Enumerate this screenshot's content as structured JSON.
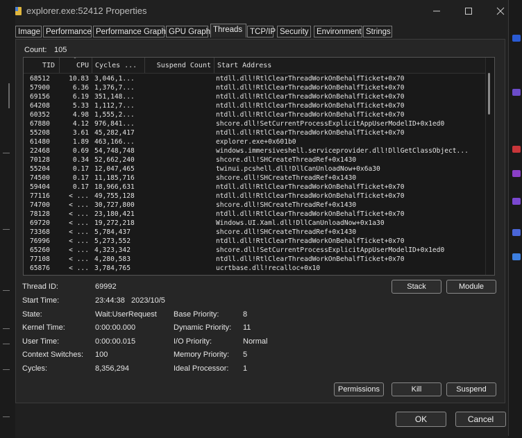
{
  "window": {
    "title": "explorer.exe:52412 Properties",
    "minimize_icon": "minimize-icon",
    "maximize_icon": "maximize-icon",
    "close_icon": "close-icon"
  },
  "tabs": [
    {
      "label": "Image"
    },
    {
      "label": "Performance"
    },
    {
      "label": "Performance Graph"
    },
    {
      "label": "GPU Graph"
    },
    {
      "label": "Threads",
      "active": true
    },
    {
      "label": "TCP/IP"
    },
    {
      "label": "Security"
    },
    {
      "label": "Environment"
    },
    {
      "label": "Strings"
    }
  ],
  "threads": {
    "count_label": "Count:",
    "count_value": "105",
    "columns": {
      "tid": "TID",
      "cpu": "CPU",
      "cycles": "Cycles ...",
      "suspend": "Suspend Count",
      "address": "Start Address"
    },
    "rows": [
      {
        "tid": "68512",
        "cpu": "10.83",
        "cycles": "3,046,1...",
        "address": "ntdll.dll!RtlClearThreadWorkOnBehalfTicket+0x70"
      },
      {
        "tid": "57900",
        "cpu": "6.36",
        "cycles": "1,376,7...",
        "address": "ntdll.dll!RtlClearThreadWorkOnBehalfTicket+0x70"
      },
      {
        "tid": "69156",
        "cpu": "6.19",
        "cycles": "351,148...",
        "address": "ntdll.dll!RtlClearThreadWorkOnBehalfTicket+0x70"
      },
      {
        "tid": "64208",
        "cpu": "5.33",
        "cycles": "1,112,7...",
        "address": "ntdll.dll!RtlClearThreadWorkOnBehalfTicket+0x70"
      },
      {
        "tid": "60352",
        "cpu": "4.98",
        "cycles": "1,555,2...",
        "address": "ntdll.dll!RtlClearThreadWorkOnBehalfTicket+0x70"
      },
      {
        "tid": "67880",
        "cpu": "4.12",
        "cycles": "976,841...",
        "address": "shcore.dll!SetCurrentProcessExplicitAppUserModelID+0x1ed0"
      },
      {
        "tid": "55208",
        "cpu": "3.61",
        "cycles": "45,282,417",
        "address": "ntdll.dll!RtlClearThreadWorkOnBehalfTicket+0x70"
      },
      {
        "tid": "61480",
        "cpu": "1.89",
        "cycles": "463,166...",
        "address": "explorer.exe+0x601b0"
      },
      {
        "tid": "22468",
        "cpu": "0.69",
        "cycles": "54,748,748",
        "address": "windows.immersiveshell.serviceprovider.dll!DllGetClassObject..."
      },
      {
        "tid": "70128",
        "cpu": "0.34",
        "cycles": "52,662,240",
        "address": "shcore.dll!SHCreateThreadRef+0x1430"
      },
      {
        "tid": "55204",
        "cpu": "0.17",
        "cycles": "12,047,465",
        "address": "twinui.pcshell.dll!DllCanUnloadNow+0x6a30"
      },
      {
        "tid": "74500",
        "cpu": "0.17",
        "cycles": "11,185,716",
        "address": "shcore.dll!SHCreateThreadRef+0x1430"
      },
      {
        "tid": "59404",
        "cpu": "0.17",
        "cycles": "18,966,631",
        "address": "ntdll.dll!RtlClearThreadWorkOnBehalfTicket+0x70"
      },
      {
        "tid": "77116",
        "cpu": "< ...",
        "cycles": "49,755,128",
        "address": "ntdll.dll!RtlClearThreadWorkOnBehalfTicket+0x70"
      },
      {
        "tid": "74700",
        "cpu": "< ...",
        "cycles": "30,727,800",
        "address": "shcore.dll!SHCreateThreadRef+0x1430"
      },
      {
        "tid": "78128",
        "cpu": "< ...",
        "cycles": "23,180,421",
        "address": "ntdll.dll!RtlClearThreadWorkOnBehalfTicket+0x70"
      },
      {
        "tid": "69720",
        "cpu": "< ...",
        "cycles": "19,272,218",
        "address": "Windows.UI.Xaml.dll!DllCanUnloadNow+0x1a30"
      },
      {
        "tid": "73368",
        "cpu": "< ...",
        "cycles": "5,784,437",
        "address": "shcore.dll!SHCreateThreadRef+0x1430"
      },
      {
        "tid": "76996",
        "cpu": "< ...",
        "cycles": "5,273,552",
        "address": "ntdll.dll!RtlClearThreadWorkOnBehalfTicket+0x70"
      },
      {
        "tid": "65260",
        "cpu": "< ...",
        "cycles": "4,323,342",
        "address": "shcore.dll!SetCurrentProcessExplicitAppUserModelID+0x1ed0"
      },
      {
        "tid": "77108",
        "cpu": "< ...",
        "cycles": "4,280,583",
        "address": "ntdll.dll!RtlClearThreadWorkOnBehalfTicket+0x70"
      },
      {
        "tid": "65876",
        "cpu": "< ...",
        "cycles": "3,784,765",
        "address": "ucrtbase.dll!recalloc+0x10"
      }
    ]
  },
  "details": {
    "thread_id_label": "Thread ID:",
    "thread_id": "69992",
    "start_time_label": "Start Time:",
    "start_time": "23:44:38   2023/10/5",
    "state_label": "State:",
    "state": "Wait:UserRequest",
    "kernel_time_label": "Kernel Time:",
    "kernel_time": "0:00:00.000",
    "user_time_label": "User Time:",
    "user_time": "0:00:00.015",
    "context_switches_label": "Context Switches:",
    "context_switches": "100",
    "cycles_label": "Cycles:",
    "cycles": "8,356,294",
    "base_priority_label": "Base Priority:",
    "base_priority": "8",
    "dynamic_priority_label": "Dynamic Priority:",
    "dynamic_priority": "11",
    "io_priority_label": "I/O Priority:",
    "io_priority": "Normal",
    "memory_priority_label": "Memory Priority:",
    "memory_priority": "5",
    "ideal_processor_label": "Ideal Processor:",
    "ideal_processor": "1"
  },
  "buttons": {
    "stack": "Stack",
    "module": "Module",
    "permissions": "Permissions",
    "kill": "Kill",
    "suspend": "Suspend",
    "ok": "OK",
    "cancel": "Cancel"
  }
}
